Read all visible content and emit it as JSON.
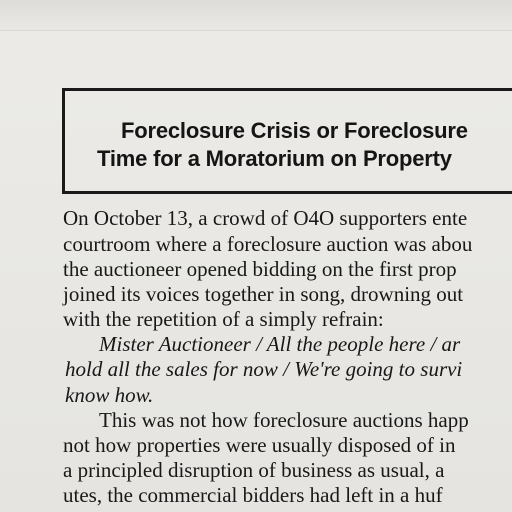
{
  "headline": {
    "line1": "Foreclosure Crisis or Foreclosure",
    "line2": "Time for a Moratorium on Property"
  },
  "body": {
    "lines": [
      "On October 13, a crowd of O4O supporters ente",
      "courtroom where a foreclosure auction was abou",
      "the auctioneer opened bidding on the first prop",
      "joined its voices together in song, drowning out",
      "with the repetition of a simply refrain:",
      "Mister Auctioneer / All the people here / ar",
      "hold all the sales for now / We're going to survi",
      "know how.",
      "This was not how foreclosure auctions happ",
      "not how properties were usually disposed of in",
      "a principled disruption of business as usual, a",
      "utes, the commercial bidders had left in a huf"
    ]
  }
}
